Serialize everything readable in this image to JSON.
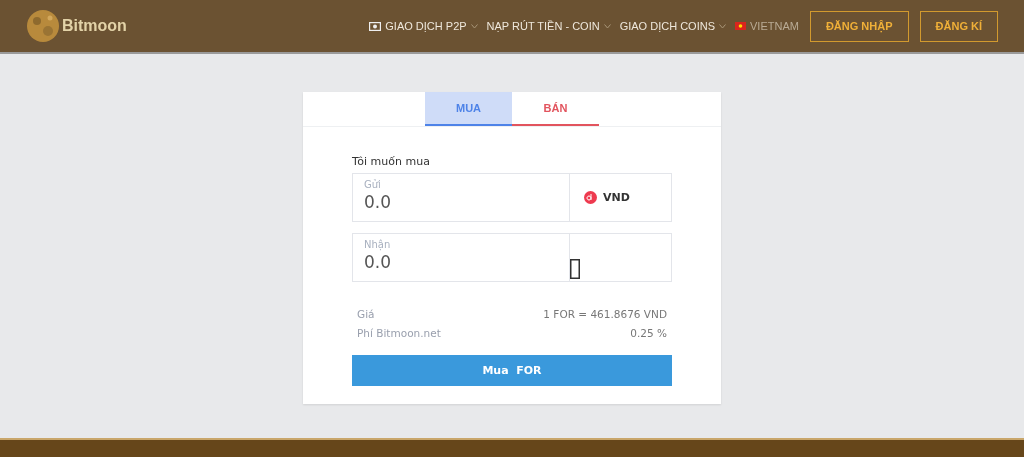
{
  "header": {
    "logo": "Bitmoon",
    "nav": [
      {
        "label": "GIAO DỊCH P2P",
        "kind": "cash",
        "dropdown": true
      },
      {
        "label": "NẠP RÚT TIỀN - COIN",
        "kind": "plain",
        "dropdown": true
      },
      {
        "label": "GIAO DỊCH COINS",
        "kind": "plain",
        "dropdown": true
      },
      {
        "label": "VIETNAM",
        "kind": "flag",
        "dropdown": false
      }
    ],
    "buttons": [
      "ĐĂNG NHẬP",
      "ĐĂNG KÍ"
    ]
  },
  "tabs": [
    {
      "label": "MUA",
      "selected": true
    },
    {
      "label": "BÁN",
      "selected": false
    }
  ],
  "form": {
    "heading": "Tôi muốn mua",
    "fields": [
      {
        "label": "Gửi",
        "value": "0.0",
        "currency": "VND",
        "kind": "currency"
      },
      {
        "label": "Nhận",
        "value": "0.0",
        "kind": "missing"
      }
    ],
    "info": [
      {
        "label": "Giá",
        "value": "1 FOR = 461.8676 VND"
      },
      {
        "label": "Phí Bitmoon.net",
        "value": "0.25 %"
      }
    ],
    "submit": "Mua  FOR"
  }
}
